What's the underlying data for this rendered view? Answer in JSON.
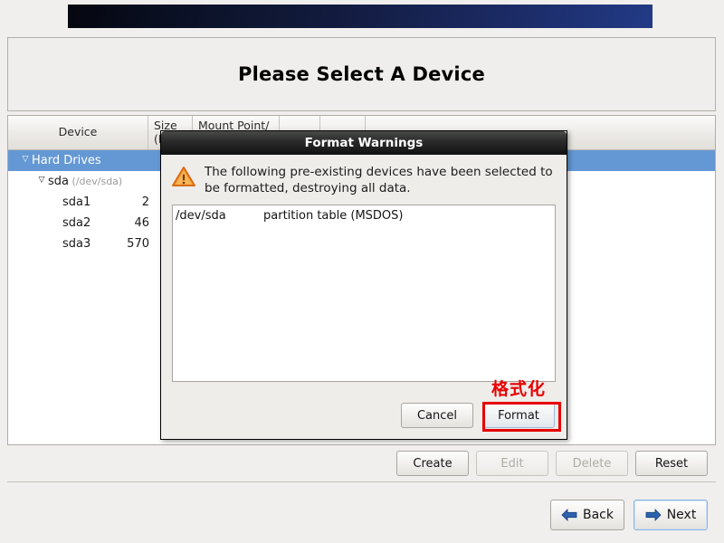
{
  "window": {
    "title": "Please Select A Device"
  },
  "table": {
    "columns": [
      {
        "label": "Device"
      },
      {
        "label": "Size\n(MB)"
      },
      {
        "label": "Mount Point/"
      },
      {
        "label": ""
      },
      {
        "label": ""
      },
      {
        "label": ""
      }
    ],
    "rows": [
      {
        "name": "Hard Drives",
        "sub": "",
        "size": "",
        "indent": 1,
        "expander": "▽",
        "selected": true
      },
      {
        "name": "sda",
        "sub": " (/dev/sda)",
        "size": "",
        "indent": 2,
        "expander": "▽",
        "selected": false
      },
      {
        "name": "sda1",
        "sub": "",
        "size": "2",
        "indent": 3,
        "expander": "",
        "selected": false
      },
      {
        "name": "sda2",
        "sub": "",
        "size": "46",
        "indent": 3,
        "expander": "",
        "selected": false
      },
      {
        "name": "sda3",
        "sub": "",
        "size": "570",
        "indent": 3,
        "expander": "",
        "selected": false
      }
    ]
  },
  "actions": {
    "create": "Create",
    "edit": "Edit",
    "delete": "Delete",
    "reset": "Reset"
  },
  "nav": {
    "back": "Back",
    "next": "Next"
  },
  "dialog": {
    "title": "Format Warnings",
    "message": "The following pre-existing devices have been selected to be formatted, destroying all data.",
    "icon": "warning-triangle-icon",
    "list": [
      "/dev/sda          partition table (MSDOS)"
    ],
    "cancel": "Cancel",
    "format": "Format"
  },
  "annotation": {
    "label": "格式化",
    "color": "#e60000"
  },
  "colors": {
    "selection_blue": "#6498d4",
    "banner_dark": "#05060f",
    "banner_light": "#223a86",
    "warning_orange": "#f0902a"
  }
}
